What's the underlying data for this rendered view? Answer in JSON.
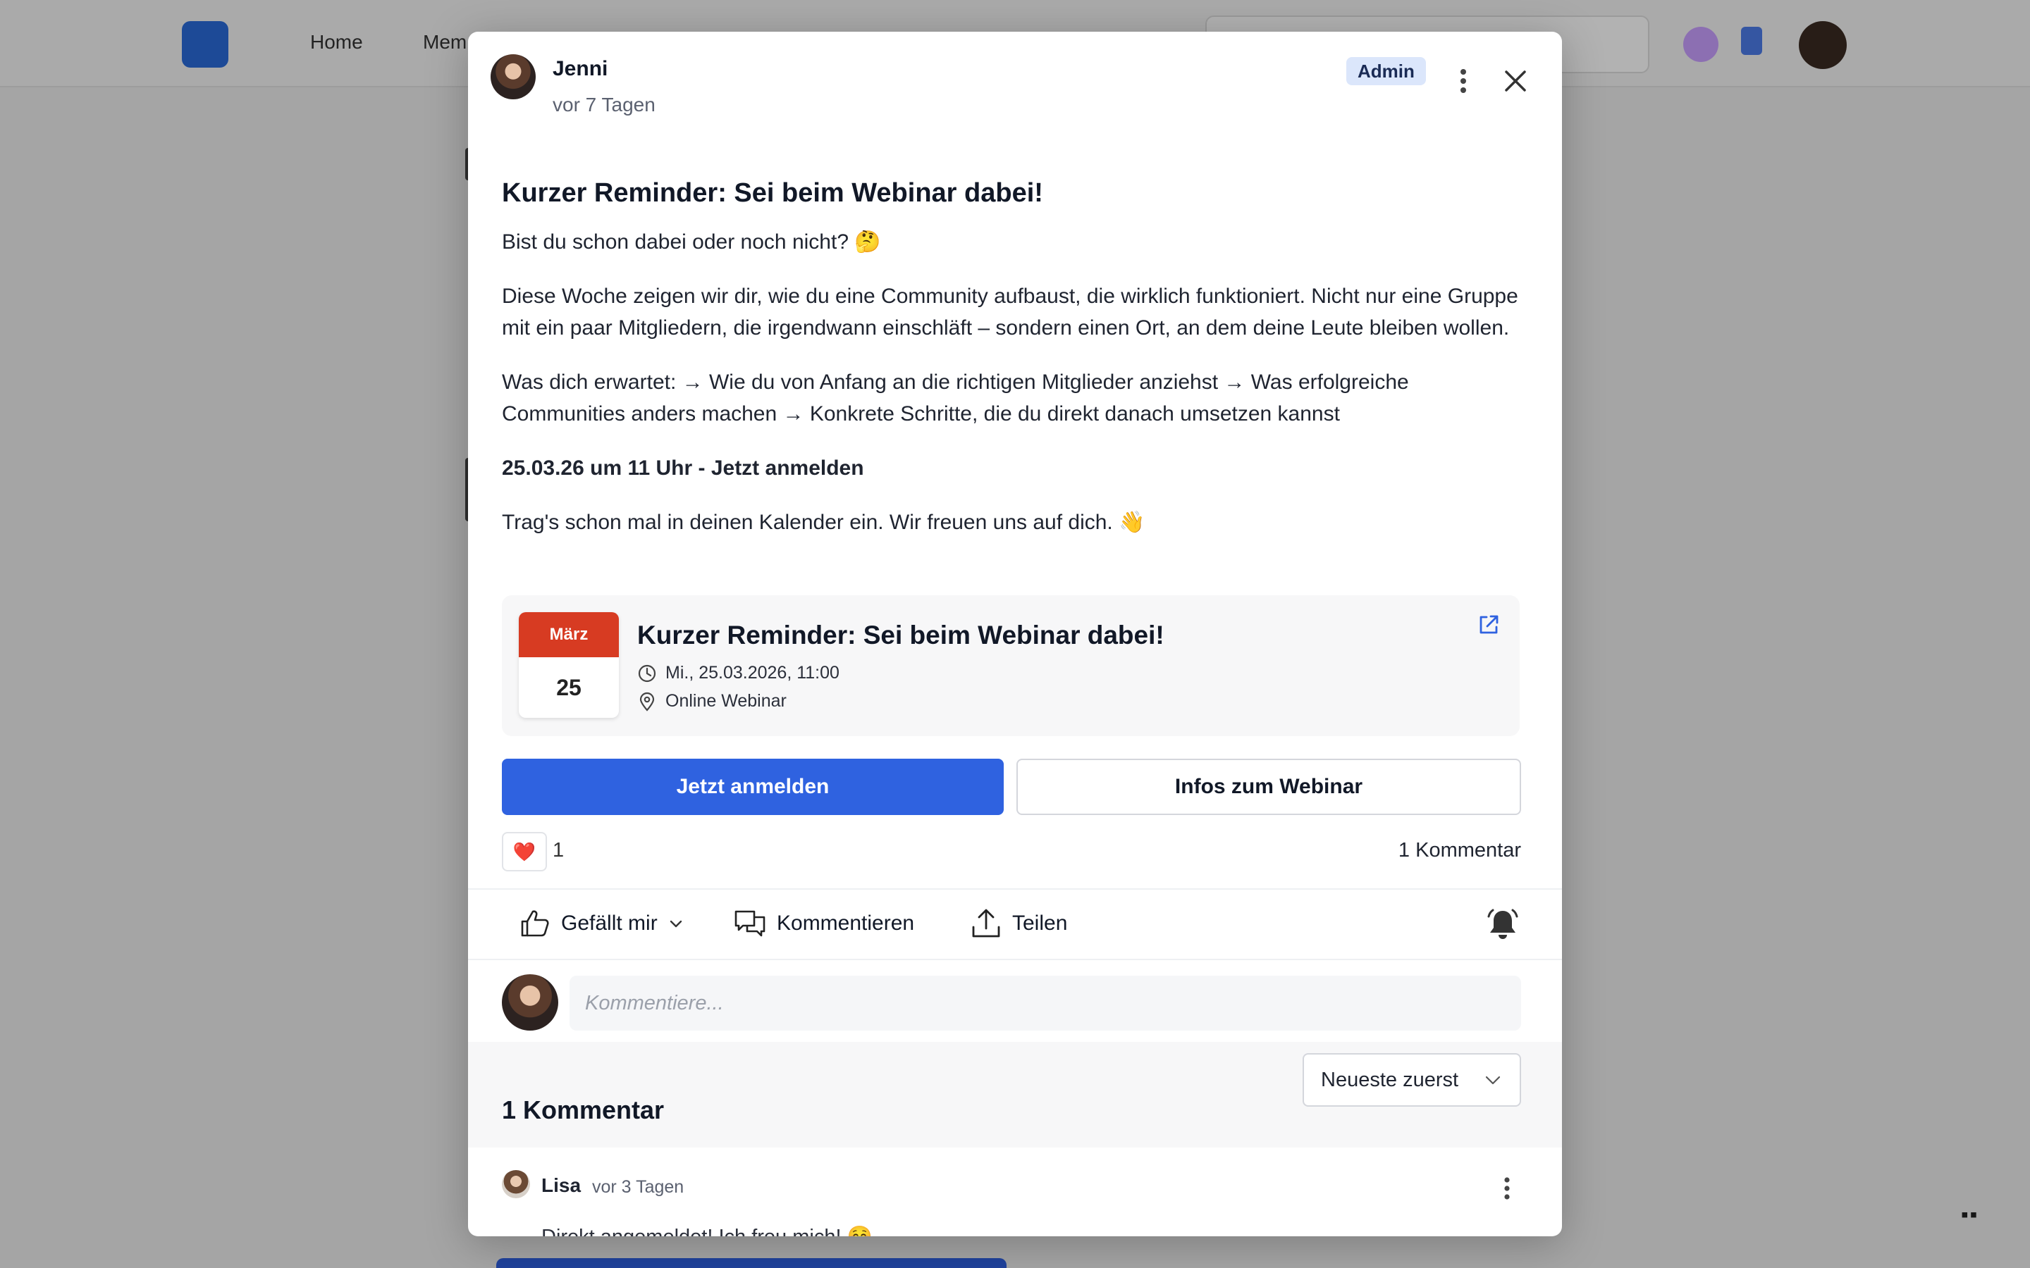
{
  "background": {
    "nav": [
      "Home",
      "Mem"
    ]
  },
  "post": {
    "author": "Jenni",
    "time": "vor 7 Tagen",
    "badge": "Admin",
    "title": "Kurzer Reminder: Sei beim Webinar dabei!",
    "paragraphs": [
      "Bist du schon dabei oder noch nicht? 🤔",
      "Diese Woche zeigen wir dir, wie du eine Community aufbaust, die wirklich funktioniert. Nicht nur eine Gruppe mit ein paar Mitgliedern, die irgendwann einschläft – sondern einen Ort, an dem deine Leute bleiben wollen.",
      "Was dich erwartet: → Wie du von Anfang an die richtigen Mitglieder anziehst → Was erfolgreiche Communities anders machen → Konkrete Schritte, die du direkt danach umsetzen kannst",
      "25.03.26 um 11 Uhr - Jetzt anmelden",
      "Trag's schon mal in deinen Kalender ein. Wir freuen uns auf dich. 👋"
    ]
  },
  "event": {
    "month": "März",
    "day": "25",
    "title": "Kurzer Reminder: Sei beim Webinar dabei!",
    "datetime": "Mi., 25.03.2026, 11:00",
    "location": "Online Webinar"
  },
  "buttons": {
    "primary": "Jetzt anmelden",
    "secondary": "Infos zum Webinar"
  },
  "reactions": {
    "emoji": "❤️",
    "count": "1",
    "comments": "1 Kommentar"
  },
  "actions": {
    "like": "Gefällt mir",
    "comment": "Kommentieren",
    "share": "Teilen"
  },
  "comment_box": {
    "placeholder": "Kommentiere..."
  },
  "comments": {
    "title": "1 Kommentar",
    "sort": "Neueste zuerst",
    "items": [
      {
        "author": "Lisa",
        "time": "vor 3 Tagen",
        "text": "Direkt angemeldet! Ich freu mich! ☺️"
      }
    ]
  },
  "colors": {
    "primary": "#2f62e0",
    "calendar_red": "#d73b22",
    "badge_bg": "#dbe6fb"
  }
}
